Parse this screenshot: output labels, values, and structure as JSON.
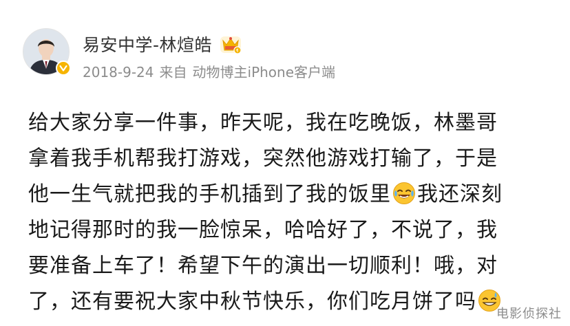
{
  "post": {
    "author": {
      "name": "易安中学-林煊皓",
      "avatar_icon": "avatar-portrait",
      "verified_icon": "verified-v-badge",
      "vip_icon": "vip-crown-icon",
      "verified_color": "#f6b400",
      "vip_color": "#f5b400"
    },
    "meta": {
      "date": "2018-9-24",
      "source_prefix": "来自",
      "source": "动物博主iPhone客户端"
    },
    "content": {
      "lines": [
        {
          "text": "给大家分享一件事，昨天呢，我在吃晚饭，林墨哥"
        },
        {
          "text": "拿着我手机帮我打游戏，突然他游戏打输了，于是"
        },
        {
          "text_before": "他一生气就把我的手机插到了我的饭里",
          "emoji": "laugh-cry-emoji",
          "text_after": "我还深刻"
        },
        {
          "text": "地记得那时的我一脸惊呆，哈哈好了，不说了，我"
        },
        {
          "text": "要准备上车了！希望下午的演出一切顺利！哦，对"
        },
        {
          "text_before": "了，还有要祝大家中秋节快乐，你们吃月饼了吗",
          "emoji": "sweat-smile-emoji",
          "text_after": ""
        }
      ]
    }
  },
  "watermark": {
    "text": "电影侦探社"
  }
}
